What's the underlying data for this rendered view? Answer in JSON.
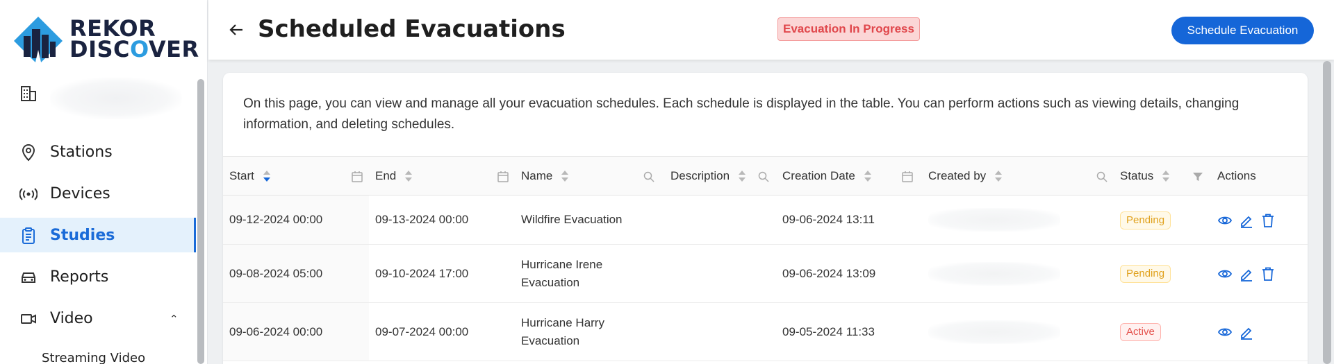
{
  "brand": {
    "line1": "REKOR",
    "line2": "DISCOVER"
  },
  "sidebar": {
    "items": [
      {
        "label": "Stations",
        "icon": "location-pin-icon"
      },
      {
        "label": "Devices",
        "icon": "broadcast-icon"
      },
      {
        "label": "Studies",
        "icon": "clipboard-icon",
        "active": true
      },
      {
        "label": "Reports",
        "icon": "car-icon"
      },
      {
        "label": "Video",
        "icon": "video-camera-icon",
        "expanded": true
      }
    ],
    "sub_items": [
      {
        "label": "Streaming Video"
      }
    ]
  },
  "header": {
    "title": "Scheduled Evacuations",
    "status_banner": "Evacuation In Progress",
    "primary_button": "Schedule Evacuation"
  },
  "intro_text": "On this page, you can view and manage all your evacuation schedules. Each schedule is displayed in the table. You can perform actions such as viewing details, changing information, and deleting schedules.",
  "table": {
    "columns": [
      {
        "label": "Start",
        "sort": "desc"
      },
      {
        "label": "End"
      },
      {
        "label": "Name"
      },
      {
        "label": "Description"
      },
      {
        "label": "Creation Date"
      },
      {
        "label": "Created by"
      },
      {
        "label": "Status"
      },
      {
        "label": "Actions"
      }
    ],
    "rows": [
      {
        "start": "09-12-2024 00:00",
        "end": "09-13-2024 00:00",
        "name": "Wildfire Evacuation",
        "description": "",
        "created": "09-06-2024 13:11",
        "status": "Pending"
      },
      {
        "start": "09-08-2024 05:00",
        "end": "09-10-2024 17:00",
        "name": "Hurricane Irene Evacuation",
        "description": "",
        "created": "09-06-2024 13:09",
        "status": "Pending"
      },
      {
        "start": "09-06-2024 00:00",
        "end": "09-07-2024 00:00",
        "name": "Hurricane Harry Evacuation",
        "description": "",
        "created": "09-05-2024 11:33",
        "status": "Active"
      }
    ]
  },
  "colors": {
    "primary": "#1566d8",
    "danger_bg": "#fbd6d6",
    "danger_text": "#e0474c",
    "pending": "#e0a11c",
    "active": "#e4514c"
  }
}
